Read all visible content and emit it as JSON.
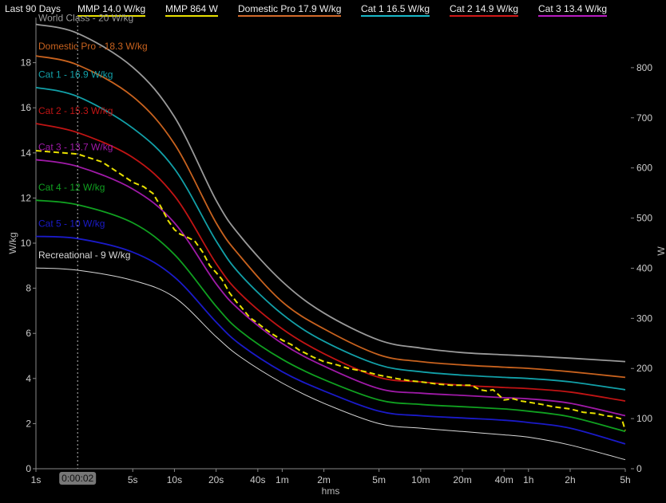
{
  "header": {
    "period": "Last 90 Days"
  },
  "legend": [
    {
      "label": "MMP  14.0 W/kg",
      "color": "#e8e000"
    },
    {
      "label": "MMP  864 W",
      "color": "#e8e000"
    },
    {
      "label": "Domestic Pro  17.9 W/kg",
      "color": "#d26a2a"
    },
    {
      "label": "Cat 1  16.5 W/kg",
      "color": "#19b8c8"
    },
    {
      "label": "Cat 2  14.9 W/kg",
      "color": "#d01818"
    },
    {
      "label": "Cat 3  13.4 W/kg",
      "color": "#b81cc0"
    }
  ],
  "cursor": {
    "label": "0:00:02"
  },
  "chart_data": {
    "type": "line",
    "xlabel": "hms",
    "ylabel": "W/kg",
    "y2label": "W",
    "x_scale": "log",
    "x_ticks": [
      {
        "label": "1s",
        "sec": 1
      },
      {
        "label": "5s",
        "sec": 5
      },
      {
        "label": "10s",
        "sec": 10
      },
      {
        "label": "20s",
        "sec": 20
      },
      {
        "label": "40s",
        "sec": 40
      },
      {
        "label": "1m",
        "sec": 60
      },
      {
        "label": "2m",
        "sec": 120
      },
      {
        "label": "5m",
        "sec": 300
      },
      {
        "label": "10m",
        "sec": 600
      },
      {
        "label": "20m",
        "sec": 1200
      },
      {
        "label": "40m",
        "sec": 2400
      },
      {
        "label": "1h",
        "sec": 3600
      },
      {
        "label": "2h",
        "sec": 7200
      },
      {
        "label": "5h",
        "sec": 18000
      }
    ],
    "xlim": [
      1,
      18000
    ],
    "ylim": [
      0,
      20
    ],
    "y_ticks": [
      "0",
      "2",
      "4",
      "6",
      "8",
      "10",
      "12",
      "14",
      "16",
      "18"
    ],
    "y2lim": [
      0,
      900
    ],
    "y2_ticks": [
      "0",
      "100",
      "200",
      "300",
      "400",
      "500",
      "600",
      "700",
      "800"
    ],
    "reference_series": [
      {
        "name": "World Class - 20 W/kg",
        "color": "#9a9a9a",
        "x": [
          1,
          2,
          5,
          10,
          20,
          30,
          60,
          120,
          300,
          600,
          1200,
          2400,
          3600,
          7200,
          18000
        ],
        "y": [
          19.7,
          19.3,
          17.8,
          15.6,
          11.9,
          10.3,
          8.3,
          6.9,
          5.7,
          5.35,
          5.15,
          5.05,
          5.0,
          4.9,
          4.75
        ]
      },
      {
        "name": "Domestic Pro - 18.3 W/kg",
        "color": "#c8621e",
        "x": [
          1,
          2,
          5,
          10,
          20,
          30,
          60,
          120,
          300,
          600,
          1200,
          2400,
          3600,
          7200,
          18000
        ],
        "y": [
          18.3,
          17.9,
          16.5,
          14.4,
          10.9,
          9.4,
          7.4,
          6.2,
          5.05,
          4.75,
          4.6,
          4.5,
          4.45,
          4.3,
          4.05
        ]
      },
      {
        "name": "Cat 1 - 16.9 W/kg",
        "color": "#12a0a8",
        "x": [
          1,
          2,
          5,
          10,
          20,
          30,
          60,
          120,
          300,
          600,
          1200,
          2400,
          3600,
          7200,
          18000
        ],
        "y": [
          16.9,
          16.5,
          15.1,
          13.3,
          10.1,
          8.6,
          6.85,
          5.65,
          4.6,
          4.3,
          4.15,
          4.05,
          4.0,
          3.85,
          3.5
        ]
      },
      {
        "name": "Cat 2 - 15.3 W/kg",
        "color": "#c01414",
        "x": [
          1,
          2,
          5,
          10,
          20,
          30,
          60,
          120,
          300,
          600,
          1200,
          2400,
          3600,
          7200,
          18000
        ],
        "y": [
          15.3,
          14.9,
          13.8,
          12.1,
          9.1,
          7.75,
          6.2,
          5.1,
          4.05,
          3.85,
          3.7,
          3.6,
          3.55,
          3.4,
          3.0
        ]
      },
      {
        "name": "Cat 3 - 13.7 W/kg",
        "color": "#a01aa8",
        "x": [
          1,
          2,
          5,
          10,
          20,
          30,
          60,
          120,
          300,
          600,
          1200,
          2400,
          3600,
          7200,
          18000
        ],
        "y": [
          13.7,
          13.4,
          12.4,
          10.9,
          8.2,
          7.0,
          5.55,
          4.55,
          3.55,
          3.35,
          3.25,
          3.15,
          3.1,
          2.9,
          2.35
        ]
      },
      {
        "name": "Cat 4 - 12 W/kg",
        "color": "#10a020",
        "x": [
          1,
          2,
          5,
          10,
          20,
          30,
          60,
          120,
          300,
          600,
          1200,
          2400,
          3600,
          7200,
          18000
        ],
        "y": [
          11.9,
          11.7,
          10.9,
          9.5,
          7.2,
          6.1,
          4.85,
          3.95,
          3.05,
          2.85,
          2.75,
          2.65,
          2.55,
          2.3,
          1.65
        ]
      },
      {
        "name": "Cat 5 - 10 W/kg",
        "color": "#1a1ac8",
        "x": [
          1,
          2,
          5,
          10,
          20,
          30,
          60,
          120,
          300,
          600,
          1200,
          2400,
          3600,
          7200,
          18000
        ],
        "y": [
          10.3,
          10.2,
          9.6,
          8.5,
          6.5,
          5.5,
          4.3,
          3.45,
          2.55,
          2.35,
          2.25,
          2.15,
          2.05,
          1.8,
          1.1
        ]
      },
      {
        "name": "Recreational - 9 W/kg",
        "color": "#d8d8d8",
        "x": [
          1,
          2,
          5,
          10,
          20,
          30,
          60,
          120,
          300,
          600,
          1200,
          2400,
          3600,
          7200,
          18000
        ],
        "y": [
          8.9,
          8.8,
          8.35,
          7.6,
          5.85,
          4.95,
          3.8,
          2.9,
          2.0,
          1.8,
          1.65,
          1.5,
          1.4,
          1.05,
          0.4
        ]
      }
    ],
    "mmp_series": {
      "name": "MMP",
      "color": "#e8e000",
      "x": [
        1,
        2,
        3,
        4,
        5,
        6,
        7,
        8,
        9,
        10,
        11,
        12,
        14,
        16,
        18,
        20,
        22,
        25,
        28,
        30,
        35,
        40,
        45,
        50,
        60,
        70,
        80,
        90,
        100,
        120,
        150,
        180,
        240,
        300,
        400,
        500,
        600,
        800,
        1000,
        1200,
        1400,
        1600,
        1800,
        2000,
        2400,
        2800,
        3200,
        3600,
        4500,
        5400,
        7200,
        9000,
        11000,
        13000,
        15000,
        17000,
        18000
      ],
      "y": [
        14.1,
        13.95,
        13.6,
        13.1,
        12.7,
        12.5,
        12.2,
        11.6,
        11.0,
        10.6,
        10.4,
        10.3,
        10.1,
        9.6,
        9.0,
        8.7,
        8.4,
        7.8,
        7.4,
        7.2,
        6.7,
        6.45,
        6.2,
        6.0,
        5.7,
        5.5,
        5.25,
        5.1,
        4.95,
        4.75,
        4.6,
        4.45,
        4.3,
        4.15,
        4.0,
        3.9,
        3.85,
        3.75,
        3.7,
        3.7,
        3.7,
        3.5,
        3.45,
        3.5,
        3.05,
        3.1,
        3.0,
        2.95,
        2.85,
        2.75,
        2.65,
        2.5,
        2.45,
        2.35,
        2.3,
        2.2,
        1.7
      ]
    }
  }
}
